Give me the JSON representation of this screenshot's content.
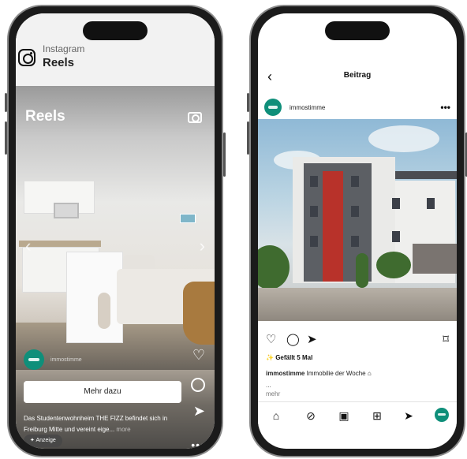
{
  "left_screen": {
    "header": {
      "app_name": "Instagram",
      "page_name": "Reels"
    },
    "reel": {
      "title": "Reels",
      "account_name": "immostimme",
      "cta_label": "Mehr dazu",
      "caption_text": "Das Studentenwohnheim THE FIZZ befindet sich in Freiburg Mitte und vereint eige...",
      "caption_more": "more",
      "badge": "Anzeige",
      "more_dots": "•••"
    },
    "icons": [
      "instagram-logo-icon",
      "camera-icon",
      "chevron-left-icon",
      "chevron-right-icon",
      "heart-icon",
      "comment-icon",
      "share-icon",
      "more-icon"
    ]
  },
  "right_screen": {
    "header": {
      "title": "Beitrag",
      "back_glyph": "‹"
    },
    "post": {
      "account_name": "immostimme",
      "menu_glyph": "•••",
      "likes": "Gefällt 5 Mal",
      "caption_user": "immostimme",
      "caption_text": "Immobilie der Woche",
      "caption_ellipsis": "...",
      "more": "mehr"
    },
    "icons": [
      "heart-icon",
      "comment-icon",
      "share-icon",
      "bookmark-icon",
      "home-icon",
      "explore-icon",
      "reels-icon",
      "create-icon",
      "send-icon",
      "profile-avatar"
    ]
  },
  "colors": {
    "brand_teal": "#0f8f7a",
    "accent_red": "#b8322a"
  }
}
